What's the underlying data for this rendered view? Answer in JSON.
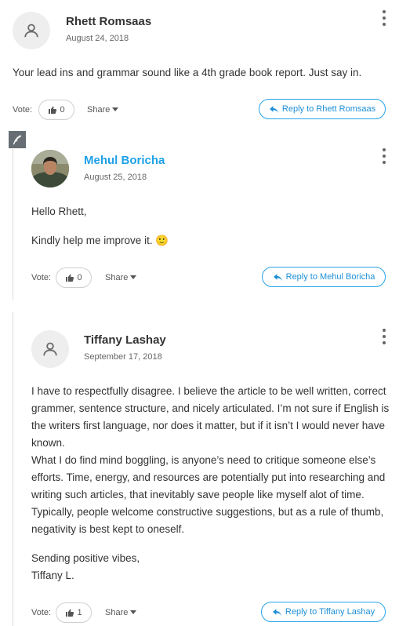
{
  "comments": [
    {
      "author": "Rhett Romsaas",
      "date": "August 24, 2018",
      "paragraphs": [
        "Your lead ins and grammar sound like a 4th grade book report. Just say in."
      ],
      "vote_label": "Vote:",
      "votes": "0",
      "share_label": "Share",
      "reply_label": "Reply to Rhett Romsaas"
    },
    {
      "author": "Mehul Boricha",
      "date": "August 25, 2018",
      "paragraphs": [
        "Hello Rhett,",
        "Kindly help me improve it. 🙂"
      ],
      "vote_label": "Vote:",
      "votes": "0",
      "share_label": "Share",
      "reply_label": "Reply to Mehul Boricha"
    },
    {
      "author": "Tiffany Lashay",
      "date": "September 17, 2018",
      "paragraphs": [
        "I have to respectfully disagree. I believe the article to be well written, correct grammer, sentence structure, and nicely articulated. I’m not sure if English is the writers first language, nor does it matter, but if it isn’t I would never have known.",
        "What I do find mind boggling, is anyone’s need to critique someone else’s efforts. Time, energy, and resources are potentially put into researching and writing such articles, that inevitably save people like myself alot of time. Typically, people welcome constructive suggestions, but as a rule of thumb, negativity is best kept to oneself.",
        "Sending positive vibes,",
        "Tiffany L."
      ],
      "vote_label": "Vote:",
      "votes": "1",
      "share_label": "Share",
      "reply_label": "Reply to Tiffany Lashay"
    }
  ],
  "icons": {
    "avatar": "user-silhouette-icon",
    "menu": "kebab-menu-icon",
    "vote": "thumbs-up-icon",
    "share": "caret-down-icon",
    "reply": "reply-arrow-icon",
    "edit": "pen-icon"
  },
  "colors": {
    "link": "#1ea0e8",
    "reply_border": "#27a4e7",
    "edit_tag": "#666e73",
    "thread_line": "#dcdcdc"
  }
}
